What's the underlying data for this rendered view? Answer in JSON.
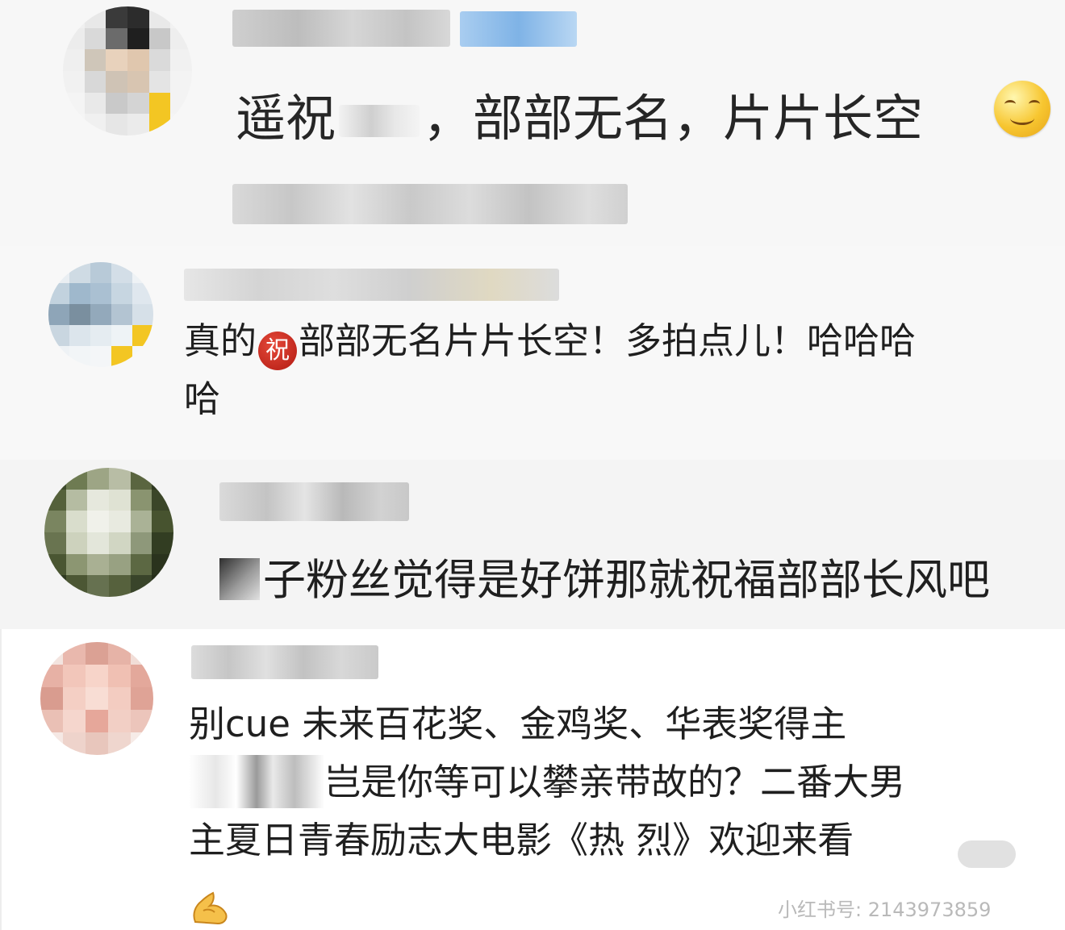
{
  "screenshots": [
    {
      "comment": "遥祝",
      "comment_rest": "，部部无名，片片长空",
      "emoji": "smile-emoji",
      "font_color": "#262626"
    },
    {
      "comment_prefix": "真的",
      "badge_char": "祝",
      "comment_line1_rest": "部部无名片片长空！多拍点儿！哈哈哈",
      "comment_line2": "哈"
    },
    {
      "comment": "子粉丝觉得是好饼那就祝福部部长风吧"
    },
    {
      "line1": "别cue  未来百花奖、金鸡奖、华表奖得主",
      "line2": "岂是你等可以攀亲带故的？二番大男",
      "line3": "主夏日青春励志大电影《热 烈》欢迎来看",
      "watermark": "小红书号: 2143973859",
      "emoji": "pray-emoji"
    }
  ],
  "colors": {
    "text": "#1f1f1f",
    "badge_red": "#c0261b",
    "vip_yellow": "#f3c623",
    "watermark": "#b9b9b9"
  }
}
